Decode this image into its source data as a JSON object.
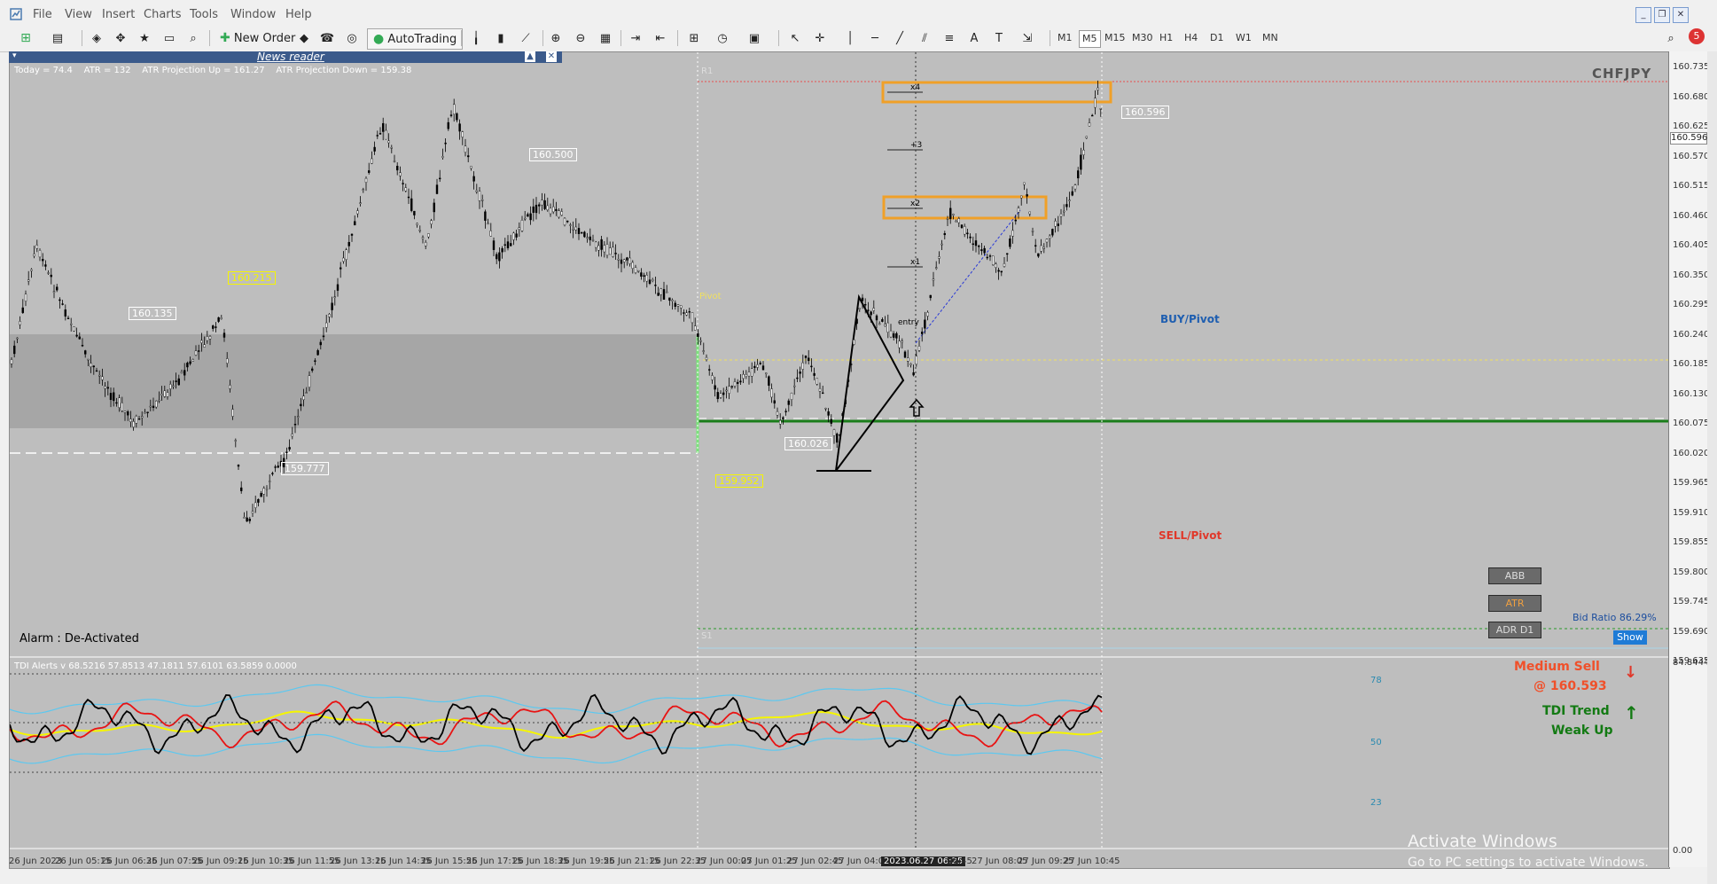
{
  "menu": [
    "File",
    "View",
    "Insert",
    "Charts",
    "Tools",
    "Window",
    "Help"
  ],
  "toolbar": {
    "new_order": "New Order",
    "autotrading": "AutoTrading",
    "notification_count": "5"
  },
  "timeframes": [
    "M1",
    "M5",
    "M15",
    "M30",
    "H1",
    "H4",
    "D1",
    "W1",
    "MN"
  ],
  "active_timeframe": "M5",
  "news_reader": {
    "title": "News reader"
  },
  "stats_line": "Today = 74.4    ATR = 132    ATR Projection Up = 161.27    ATR Projection Down = 159.38",
  "symbol": "CHFJPY",
  "price_axis": [
    "160.735",
    "160.680",
    "160.625",
    "160.570",
    "160.515",
    "160.460",
    "160.405",
    "160.350",
    "160.295",
    "160.240",
    "160.185",
    "160.130",
    "160.075",
    "160.020",
    "159.965",
    "159.910",
    "159.855",
    "159.800",
    "159.745",
    "159.690",
    "159.635"
  ],
  "current_price": "160.596",
  "indicator_axis": {
    "top": "84.8444",
    "bottom": "0.00"
  },
  "price_labels": {
    "p1": "160.500",
    "p2": "160.135",
    "p3": "160.215",
    "p4": "159.777",
    "p5": "159.952",
    "p6": "160.026",
    "p7": "160.596"
  },
  "level_labels": {
    "r1": "R1",
    "s1": "S1",
    "pivot": "Pivot",
    "x4": "x4",
    "x3": "+3",
    "x2": "x2",
    "x1": "x1",
    "entry": "entry"
  },
  "alarm": "Alarm : De-Activated",
  "buy_pivot": "BUY/Pivot",
  "sell_pivot": "SELL/Pivot",
  "buttons": {
    "abb": "ABB",
    "atr": "ATR",
    "adr": "ADR D1",
    "show": "Show"
  },
  "bid_ratio": "Bid Ratio 86.29%",
  "signal": {
    "line1": "Medium Sell",
    "line2": "@ 160.593",
    "trend1": "TDI Trend",
    "trend2": "Weak Up"
  },
  "tdi_title": "TDI Alerts v 68.5216 57.8513 47.1811 57.6101 63.5859 0.0000",
  "tdi_levels": [
    "78",
    "50",
    "23"
  ],
  "time_labels": [
    "26 Jun 2023",
    "26 Jun 05:15",
    "26 Jun 06:35",
    "26 Jun 07:55",
    "26 Jun 09:15",
    "26 Jun 10:35",
    "26 Jun 11:55",
    "26 Jun 13:15",
    "26 Jun 14:35",
    "26 Jun 15:55",
    "26 Jun 17:15",
    "26 Jun 18:35",
    "26 Jun 19:55",
    "26 Jun 21:15",
    "26 Jun 22:35",
    "27 Jun 00:05",
    "27 Jun 01:25",
    "27 Jun 02:45",
    "27 Jun 04:05",
    "2023.06.27 06:25",
    "06:45",
    "27 Jun 08:05",
    "27 Jun 09:25",
    "27 Jun 10:45"
  ],
  "watermark": {
    "line1": "Activate Windows",
    "line2": "Go to PC settings to activate Windows."
  },
  "colors": {
    "chart_bg": "#bebebe",
    "rsi_line": "#000000",
    "signal_line": "#e81313",
    "market_base": "#f5f500",
    "volatility_band": "#5cc8f0",
    "pivot_green": "#1a7d1a",
    "box_orange": "#f0a028"
  }
}
